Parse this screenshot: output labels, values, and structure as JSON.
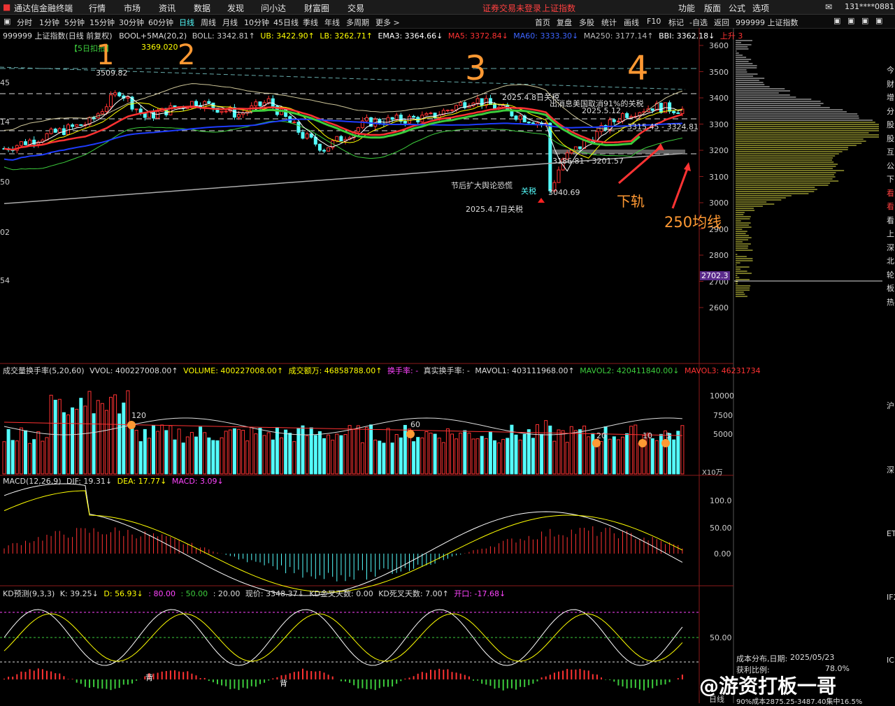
{
  "titlebar": {
    "app_name": "通达信金融终端",
    "menu": [
      "行情",
      "市场",
      "资讯",
      "数据",
      "发现",
      "问小达",
      "财富圈",
      "交易"
    ],
    "login_status": "证券交易未登录",
    "index_name": "上证指数",
    "right_menu": [
      "功能",
      "版面",
      "公式",
      "选项"
    ],
    "account": "131****0881"
  },
  "periods": [
    "分时",
    "1分钟",
    "5分钟",
    "15分钟",
    "30分钟",
    "60分钟",
    "日线",
    "周线",
    "月线",
    "10分钟",
    "45日线",
    "季线",
    "年线",
    "多周期",
    "更多 >"
  ],
  "right_tools": [
    "首页",
    "复盘",
    "多股",
    "统计",
    "画线",
    "F10",
    "标记",
    "-自选",
    "返回"
  ],
  "side_panel": {
    "title": "999999 上证指数",
    "current_price": "2702.3",
    "cost_label": "成本分布,日期:",
    "cost_date": "2025/05/23",
    "profit_label": "获利比例:",
    "profit_ratio": "78.0%",
    "cost_90": "90%成本2875.25-3487.40集中16.5%",
    "right_letters": [
      "今",
      "财",
      "增",
      "分",
      "股",
      "股",
      "互",
      "公",
      "下",
      "看",
      "看",
      "看",
      "上",
      "深",
      "北",
      "轮",
      "板",
      "热"
    ]
  },
  "main_header": {
    "symbol": "999999 上证指数(日线 前复权)",
    "indicator": "BOOL+5MA(20,2)",
    "boll": "BOLL: 3342.81↑",
    "ub": "UB: 3422.90↑",
    "lb": "LB: 3262.71↑",
    "ema3": "EMA3: 3364.66↓",
    "ma5": "MA5: 3372.84↓",
    "ma60": "MA60: 3333.30↓",
    "ma250": "MA250: 3177.14↑",
    "bbi": "BBI: 3362.18↓",
    "trend": "上升 3"
  },
  "price_axis": [
    "3600",
    "3500",
    "3400",
    "3300",
    "3200",
    "3100",
    "3000",
    "2900",
    "2800",
    "2700",
    "2600"
  ],
  "left_axis": [
    "45",
    "14",
    "50",
    "02",
    "54"
  ],
  "price_annotations": {
    "five_day": "【5日扣抵】",
    "high1": "3509.82",
    "high2": "3369.020",
    "tariff_20250408": "2025.4.8日关税",
    "us_tariff_news": "出消息美国取消91%的关税",
    "date_0512": "2025.5.12",
    "range1": "3315.45 - 3324.81",
    "range2": "3186.81 - 3201.57",
    "low": "3040.69",
    "holiday_fear": "节后扩大舆论恐慌",
    "guanshui": "关税",
    "tariff_20250407": "2025.4.7日关税",
    "lower_rail": "下轨",
    "ma250_line": "250均线",
    "hand_1": "1",
    "hand_2": "2",
    "hand_3": "3",
    "hand_4": "4"
  },
  "volume_header": {
    "name": "成交量换手率(5,20,60)",
    "vvol": "VVOL: 400227008.00↑",
    "volume": "VOLUME: 400227008.00↑",
    "amount": "成交额万: 46858788.00↑",
    "turnover": "换手率: -",
    "real_turnover": "真实换手率: -",
    "mavol1": "MAVOL1: 403111968.00↑",
    "mavol2": "MAVOL2: 420411840.00↓",
    "mavol3": "MAVOL3: 46231734"
  },
  "volume_axis": [
    "10000",
    "7500",
    "5000",
    "X10万"
  ],
  "volume_marks": [
    "120",
    "60",
    "20",
    "10",
    "5"
  ],
  "macd_header": {
    "name": "MACD(12,26,9)",
    "dif": "DIF: 19.31↓",
    "dea": "DEA: 17.77↓",
    "macd": "MACD: 3.09↓"
  },
  "macd_axis": [
    "100.0",
    "50.00",
    "0.00"
  ],
  "kd_header": {
    "name": "KD预测(9,3,3)",
    "k": "K: 39.25↓",
    "d": "D: 56.93↓",
    "l80": ": 80.00",
    "l50": ": 50.00",
    "l20": ": 20.00",
    "price": "现价: 3348.37↓",
    "gold": "KD金叉天数: 0.00",
    "dead": "KD死叉天数: 7.00↑",
    "open": "开口: -17.68↓"
  },
  "kd_axis": [
    "50.00"
  ],
  "kd_labels": [
    "背",
    "背"
  ],
  "right_edge_labels": [
    "沪",
    "深",
    "ET",
    "IF2",
    "IC"
  ],
  "bottom_label": "日线",
  "watermark": "@游资打板一哥",
  "colors": {
    "up": "#ff3232",
    "down": "#54fcfc",
    "ma_yellow": "#ffff00",
    "ma_green": "#3ccc3c",
    "ma_blue": "#1e3cff",
    "grid_red": "#8b1a1a",
    "accent_orange": "#ff9933"
  }
}
